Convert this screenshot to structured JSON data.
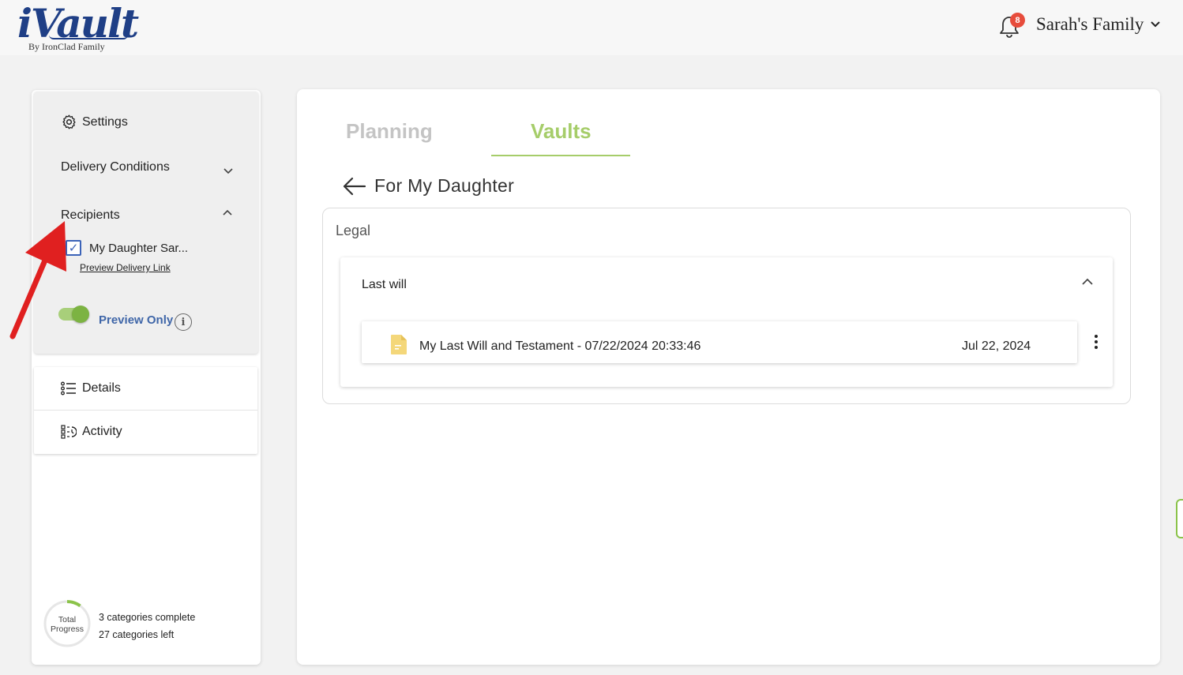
{
  "header": {
    "logo_text": "iVault",
    "logo_tagline": "By IronClad Family",
    "notification_count": "8",
    "account_name": "Sarah's Family"
  },
  "sidebar": {
    "settings_label": "Settings",
    "delivery_conditions_label": "Delivery Conditions",
    "recipients_label": "Recipients",
    "recipient_name": "My Daughter Sar...",
    "recipient_checked": true,
    "preview_link_label": "Preview Delivery Link",
    "preview_only_label": "Preview Only",
    "preview_only_enabled": true,
    "menu": [
      {
        "label": "Details",
        "icon": "list-icon"
      },
      {
        "label": "Activity",
        "icon": "activity-icon"
      }
    ],
    "progress": {
      "label_line1": "Total",
      "label_line2": "Progress",
      "complete_text": "3 categories complete",
      "left_text": "27 categories left",
      "fraction_complete": 0.1
    }
  },
  "main": {
    "tabs": [
      {
        "label": "Planning",
        "active": false
      },
      {
        "label": "Vaults",
        "active": true
      }
    ],
    "vault_title": "For My Daughter",
    "category_label": "Legal",
    "section_title": "Last will",
    "document": {
      "name": "My Last Will and Testament - 07/22/2024 20:33:46",
      "date": "Jul 22, 2024",
      "icon": "document-icon"
    }
  },
  "colors": {
    "accent_green": "#a6cd6a",
    "toggle_green": "#7cb342",
    "link_blue": "#3f66a8",
    "brand_blue": "#1f3f86",
    "badge_red": "#e74c3c",
    "annotation_red": "#e02020"
  }
}
